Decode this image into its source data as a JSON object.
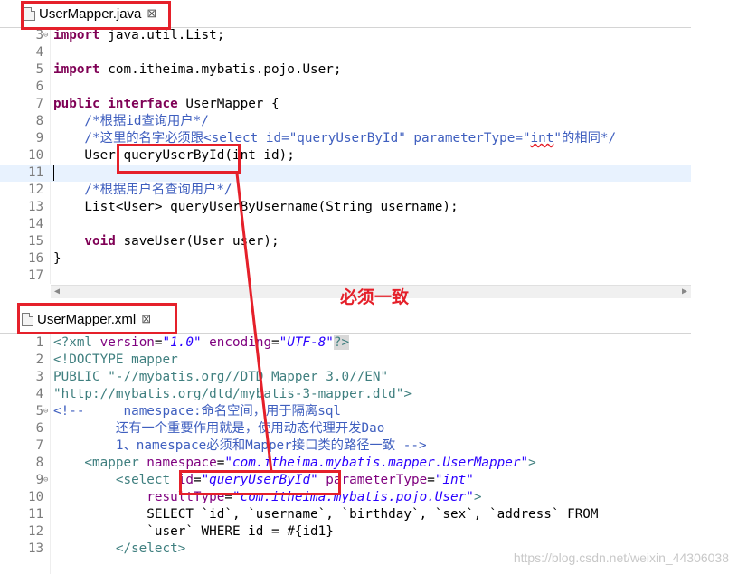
{
  "annotation": "必须一致",
  "watermark": "https://blog.csdn.net/weixin_44306038",
  "java_tab": {
    "title": "UserMapper.java",
    "close": "⊠"
  },
  "xml_tab": {
    "title": "UserMapper.xml",
    "close": "⊠"
  },
  "java_lines": [
    {
      "n": "3",
      "fold": "⊖"
    },
    {
      "n": "4"
    },
    {
      "n": "5"
    },
    {
      "n": "6"
    },
    {
      "n": "7"
    },
    {
      "n": "8"
    },
    {
      "n": "9"
    },
    {
      "n": "10"
    },
    {
      "n": "11"
    },
    {
      "n": "12"
    },
    {
      "n": "13"
    },
    {
      "n": "14"
    },
    {
      "n": "15"
    },
    {
      "n": "16"
    },
    {
      "n": "17"
    }
  ],
  "java_code": {
    "l3_kw": "import",
    "l3_rest": " java.util.List;",
    "l5_kw": "import",
    "l5_rest": " com.itheima.mybatis.pojo.User;",
    "l7_kw1": "public",
    "l7_kw2": "interface",
    "l7_rest": " UserMapper {",
    "l8": "    /*根据id查询用户*/",
    "l9_a": "    /*这里的名字必须跟<select id=\"queryUserById\" parameterType=\"",
    "l9_b": "int",
    "l9_c": "\"的相同*/",
    "l10_a": "    User ",
    "l10_b": "queryUserById",
    "l10_c": "(int id);",
    "l12": "    /*根据用户名查询用户*/",
    "l13": "    List<User> queryUserByUsername(String username);",
    "l15_kw": "    void",
    "l15_rest": " saveUser(User user);",
    "l16": "}"
  },
  "xml_lines": [
    {
      "n": "1"
    },
    {
      "n": "2"
    },
    {
      "n": "3"
    },
    {
      "n": "4"
    },
    {
      "n": "5",
      "fold": "⊖"
    },
    {
      "n": "6"
    },
    {
      "n": "7"
    },
    {
      "n": "8"
    },
    {
      "n": "9",
      "fold": "⊖"
    },
    {
      "n": "10"
    },
    {
      "n": "11"
    },
    {
      "n": "12"
    },
    {
      "n": "13"
    }
  ],
  "xml_code": {
    "l1_a": "<?xml ",
    "l1_b": "version",
    "l1_c": "=",
    "l1_d": "\"1.0\"",
    "l1_e": " encoding",
    "l1_f": "=",
    "l1_g": "\"UTF-8\"",
    "l1_h": "?>",
    "l2": "<!DOCTYPE mapper",
    "l3_a": "PUBLIC ",
    "l3_b": "\"-//mybatis.org//DTD Mapper 3.0//EN\"",
    "l4": "\"http://mybatis.org/dtd/mybatis-3-mapper.dtd\">",
    "l5_a": "<!--",
    "l5_b": "     namespace:命名空间，用于隔离sql",
    "l6": "        还有一个重要作用就是，使用动态代理开发Dao",
    "l7": "        1、namespace必须和Mapper接口类的路径一致 -->",
    "l8_a": "    <mapper ",
    "l8_b": "namespace",
    "l8_c": "=",
    "l8_d": "\"com.itheima.mybatis.mapper.UserMapper\"",
    "l8_e": ">",
    "l9_a": "        <select ",
    "l9_b": "id",
    "l9_c": "=",
    "l9_d": "\"queryUserById\"",
    "l9_e": " parameterType",
    "l9_f": "=",
    "l9_g": "\"int\"",
    "l10_a": "            resultType",
    "l10_b": "=",
    "l10_c": "\"com.itheima.mybatis.pojo.User\"",
    "l10_d": ">",
    "l11": "            SELECT `id`, `username`, `birthday`, `sex`, `address` FROM",
    "l12": "            `user` WHERE id = #{id1}",
    "l13": "        </select>"
  },
  "scroll": {
    "left": "◀",
    "right": "▶"
  }
}
